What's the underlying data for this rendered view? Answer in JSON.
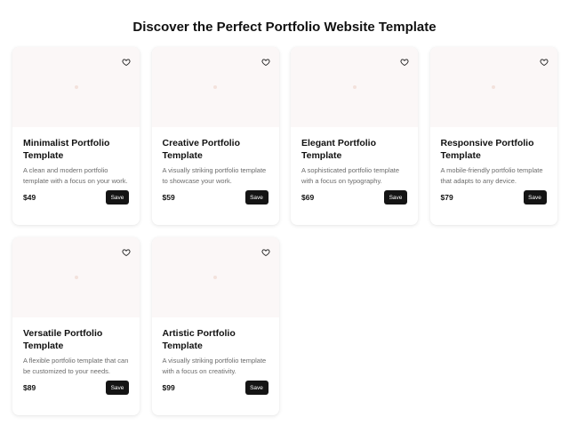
{
  "header": {
    "title": "Discover the Perfect Portfolio Website Template"
  },
  "theme": {
    "image_bg": "#fbf7f7",
    "button_bg": "#141414",
    "button_text": "#ffffff",
    "desc_text": "#6b6b6b"
  },
  "icons": {
    "favorite": "heart-outline-icon"
  },
  "templates": [
    {
      "title": "Minimalist Portfolio Template",
      "description": "A clean and modern portfolio template with a focus on your work.",
      "price": "$49",
      "save_label": "Save"
    },
    {
      "title": "Creative Portfolio Template",
      "description": "A visually striking portfolio template to showcase your work.",
      "price": "$59",
      "save_label": "Save"
    },
    {
      "title": "Elegant Portfolio Template",
      "description": "A sophisticated portfolio template with a focus on typography.",
      "price": "$69",
      "save_label": "Save"
    },
    {
      "title": "Responsive Portfolio Template",
      "description": "A mobile-friendly portfolio template that adapts to any device.",
      "price": "$79",
      "save_label": "Save"
    },
    {
      "title": "Versatile Portfolio Template",
      "description": "A flexible portfolio template that can be customized to your needs.",
      "price": "$89",
      "save_label": "Save"
    },
    {
      "title": "Artistic Portfolio Template",
      "description": "A visually striking portfolio template with a focus on creativity.",
      "price": "$99",
      "save_label": "Save"
    }
  ]
}
